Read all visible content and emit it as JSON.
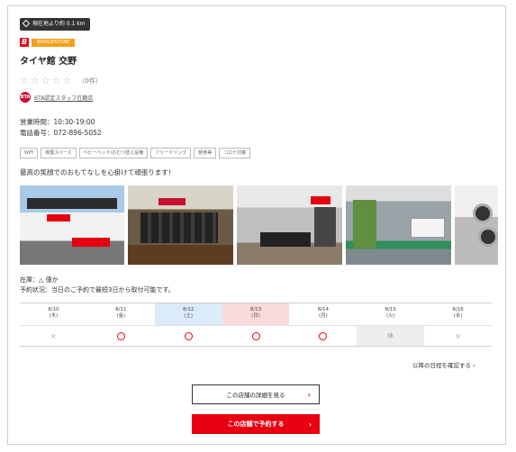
{
  "distance_badge": "現在地より約 0.1 km",
  "brand": {
    "tag": "BRIDGESTONE",
    "logo_letter": "B"
  },
  "store_name": "タイヤ館 交野",
  "rating": {
    "count_label": "（0件）"
  },
  "staff": {
    "icon_text": "BTA",
    "link": "BTA認定スタッフ在籍店"
  },
  "hours": "営業時間：10:30-19:00",
  "phone": "電話番号：072-896-5052",
  "amenities": [
    "WiFi",
    "喫煙スペース",
    "ベビーベッド/おむつ替え設備",
    "フリードリンク",
    "軽食等",
    "コロナ対策"
  ],
  "motto": "最高の笑顔でのおもてなしを心掛けて頑張ります！",
  "photos": [
    "store-exterior",
    "tire-display",
    "waiting-area",
    "pit-service",
    "wheel-rack"
  ],
  "stock": "在庫：△ 僅か",
  "reservation_status": "予約状況：当日のご予約で最短3日から取付可能です。",
  "calendar": [
    {
      "date": "8/10",
      "day": "(木)",
      "status": "×"
    },
    {
      "date": "8/11",
      "day": "(金)",
      "status": "○"
    },
    {
      "date": "8/12",
      "day": "(土)",
      "status": "○"
    },
    {
      "date": "8/13",
      "day": "(日)",
      "status": "○"
    },
    {
      "date": "8/14",
      "day": "(月)",
      "status": "○"
    },
    {
      "date": "8/15",
      "day": "(火)",
      "status": "休"
    },
    {
      "date": "8/16",
      "day": "(水)",
      "status": "×"
    }
  ],
  "next_schedule_link": "以降の日程を確認する",
  "detail_button": "この店舗の詳細を見る",
  "reserve_button": "この店舗で予約する",
  "colors": {
    "accent": "#e60012",
    "saturday": "#dcebfa",
    "sunday": "#fadadd",
    "closed": "#eeeeee"
  }
}
